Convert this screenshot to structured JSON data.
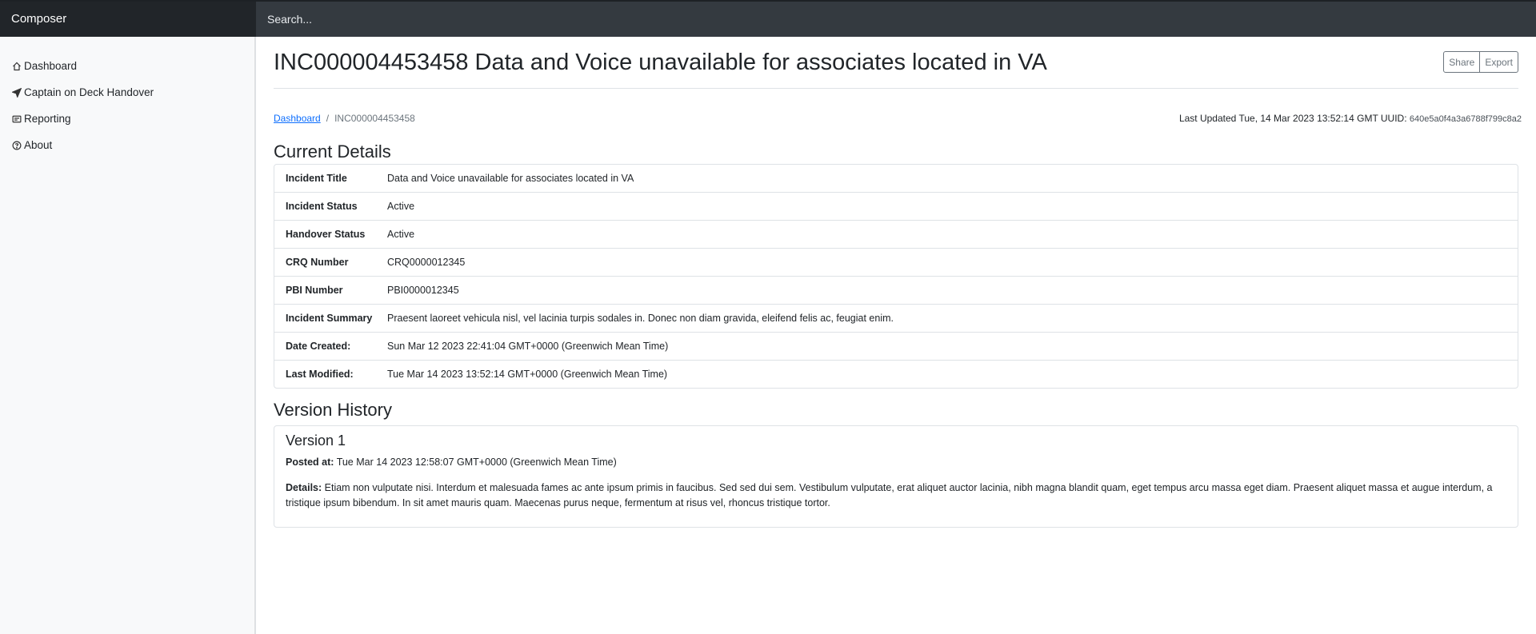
{
  "app": {
    "brand": "Composer"
  },
  "search": {
    "placeholder": "Search..."
  },
  "sidebar": {
    "items": [
      {
        "label": "Dashboard",
        "icon": "house-icon"
      },
      {
        "label": "Captain on Deck Handover",
        "icon": "send-icon"
      },
      {
        "label": "Reporting",
        "icon": "card-text-icon"
      },
      {
        "label": "About",
        "icon": "question-circle-icon"
      }
    ]
  },
  "header": {
    "title": "INC000004453458 Data and Voice unavailable for associates located in VA",
    "share_label": "Share",
    "export_label": "Export"
  },
  "breadcrumb": {
    "root": "Dashboard",
    "separator": "/",
    "current": "INC000004453458"
  },
  "meta": {
    "last_updated": "Last Updated Tue, 14 Mar 2023 13:52:14 GMT UUID:",
    "uuid": "640e5a0f4a3a6788f799c8a2"
  },
  "details": {
    "heading": "Current Details",
    "rows": [
      {
        "key": "Incident Title",
        "value": "Data and Voice unavailable for associates located in VA"
      },
      {
        "key": "Incident Status",
        "value": "Active"
      },
      {
        "key": "Handover Status",
        "value": "Active"
      },
      {
        "key": "CRQ Number",
        "value": "CRQ0000012345"
      },
      {
        "key": "PBI Number",
        "value": "PBI0000012345"
      },
      {
        "key": "Incident Summary",
        "value": "Praesent laoreet vehicula nisl, vel lacinia turpis sodales in. Donec non diam gravida, eleifend felis ac, feugiat enim."
      },
      {
        "key": "Date Created:",
        "value": "Sun Mar 12 2023 22:41:04 GMT+0000 (Greenwich Mean Time)"
      },
      {
        "key": "Last Modified:",
        "value": "Tue Mar 14 2023 13:52:14 GMT+0000 (Greenwich Mean Time)"
      }
    ]
  },
  "history": {
    "heading": "Version History",
    "versions": [
      {
        "title": "Version 1",
        "posted_label": "Posted at:",
        "posted_value": "Tue Mar 14 2023 12:58:07 GMT+0000 (Greenwich Mean Time)",
        "details_label": "Details:",
        "details_value": "Etiam non vulputate nisi. Interdum et malesuada fames ac ante ipsum primis in faucibus. Sed sed dui sem. Vestibulum vulputate, erat aliquet auctor lacinia, nibh magna blandit quam, eget tempus arcu massa eget diam. Praesent aliquet massa et augue interdum, a tristique ipsum bibendum. In sit amet mauris quam. Maecenas purus neque, fermentum at risus vel, rhoncus tristique tortor."
      }
    ]
  }
}
